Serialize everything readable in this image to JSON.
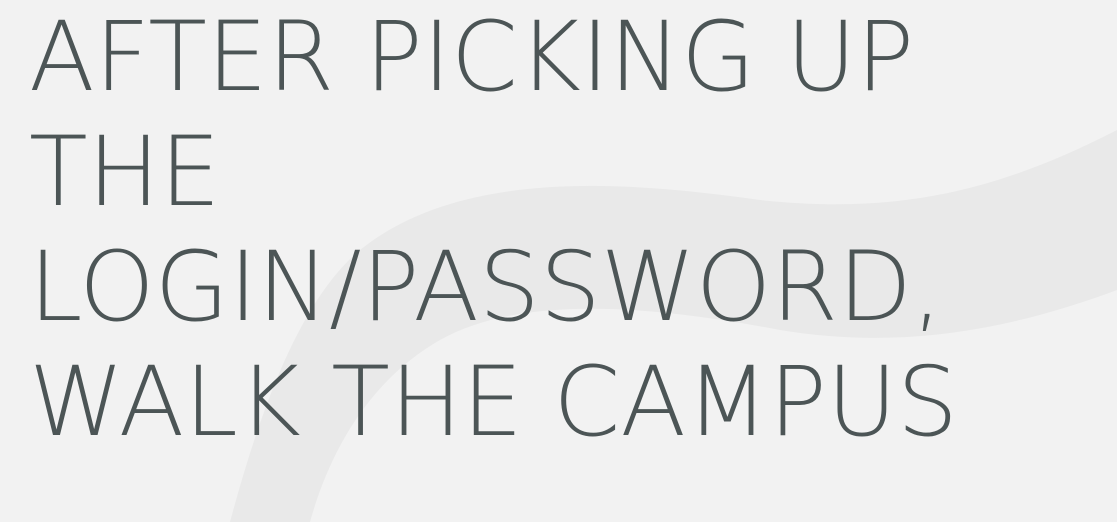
{
  "headline": {
    "lines": [
      "AFTER PICKING UP",
      "THE",
      "LOGIN/PASSWORD,",
      "WALK THE CAMPUS"
    ]
  },
  "colors": {
    "background": "#f2f2f2",
    "text": "#4c5556",
    "decorative_shape": "#e9e9e9"
  }
}
